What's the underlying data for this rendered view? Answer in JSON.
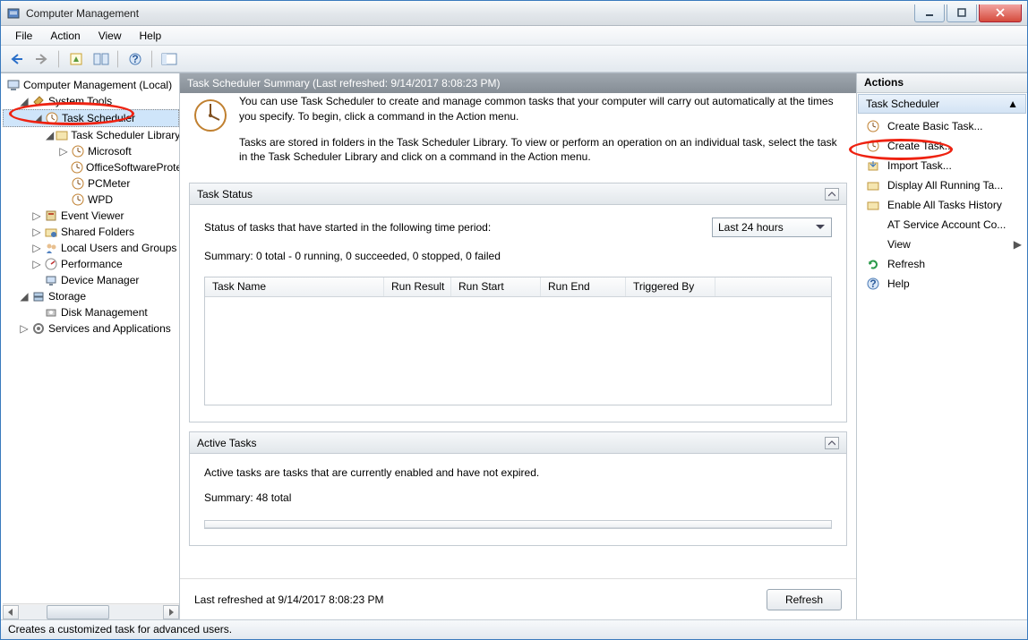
{
  "window": {
    "title": "Computer Management"
  },
  "menu": {
    "file": "File",
    "action": "Action",
    "view": "View",
    "help": "Help"
  },
  "tree": {
    "root": "Computer Management (Local)",
    "systemTools": "System Tools",
    "taskScheduler": "Task Scheduler",
    "taskSchedulerLibrary": "Task Scheduler Library",
    "microsoft": "Microsoft",
    "officeSoftware": "OfficeSoftwareProte",
    "pcMeter": "PCMeter",
    "wpd": "WPD",
    "eventViewer": "Event Viewer",
    "sharedFolders": "Shared Folders",
    "localUsers": "Local Users and Groups",
    "performance": "Performance",
    "deviceManager": "Device Manager",
    "storage": "Storage",
    "diskManagement": "Disk Management",
    "services": "Services and Applications"
  },
  "mid": {
    "header": "Task Scheduler Summary (Last refreshed: 9/14/2017 8:08:23 PM)",
    "desc1": "You can use Task Scheduler to create and manage common tasks that your computer will carry out automatically at the times you specify. To begin, click a command in the Action menu.",
    "desc2": "Tasks are stored in folders in the Task Scheduler Library. To view or perform an operation on an individual task, select the task in the Task Scheduler Library and click on a command in the Action menu.",
    "taskStatus": {
      "title": "Task Status",
      "prompt": "Status of tasks that have started in the following time period:",
      "period": "Last 24 hours",
      "summary": "Summary: 0 total - 0 running, 0 succeeded, 0 stopped, 0 failed",
      "cols": {
        "name": "Task Name",
        "runResult": "Run Result",
        "runStart": "Run Start",
        "runEnd": "Run End",
        "triggered": "Triggered By"
      }
    },
    "activeTasks": {
      "title": "Active Tasks",
      "desc": "Active tasks are tasks that are currently enabled and have not expired.",
      "summary": "Summary: 48 total"
    },
    "footer": "Last refreshed at 9/14/2017 8:08:23 PM",
    "refresh": "Refresh"
  },
  "actions": {
    "title": "Actions",
    "sub": "Task Scheduler",
    "items": {
      "createBasic": "Create Basic Task...",
      "createTask": "Create Task...",
      "importTask": "Import Task...",
      "displayRunning": "Display All Running Ta...",
      "enableHistory": "Enable All Tasks History",
      "atService": "AT Service Account Co...",
      "view": "View",
      "refresh": "Refresh",
      "help": "Help"
    }
  },
  "status": "Creates a customized task for advanced users."
}
